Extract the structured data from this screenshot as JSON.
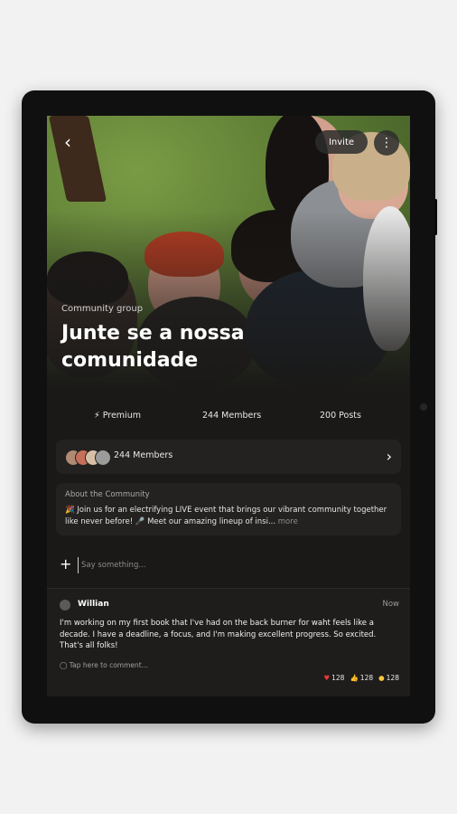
{
  "header": {
    "invite_label": "Invite"
  },
  "community": {
    "type_label": "Community group",
    "title": "Junte se a nossa comunidade"
  },
  "stats": {
    "premium_label": "Premium",
    "members_label": "244 Members",
    "posts_label": "200 Posts"
  },
  "members_card": {
    "label": "244 Members"
  },
  "about": {
    "title": "About the Community",
    "text": "🎉 Join us for an electrifying LIVE event that brings our vibrant  community together like never before! 🎤 Meet our amazing lineup of  insi...",
    "more_label": "more"
  },
  "compose": {
    "placeholder": "Say something..."
  },
  "post": {
    "author": "Willian",
    "time": "Now",
    "body": "I'm working on my first book that I've had on the back burner for waht feels like a decade. I have a deadline, a focus, and I'm making excellent progress. So excited. That's all folks!",
    "comment_prompt": "Tap here to comment...",
    "reactions": {
      "heart": "128",
      "thumbs_up": "128",
      "other": "128"
    }
  },
  "colors": {
    "background": "#f2f2f2",
    "device": "#101010",
    "screen": "#1a1918",
    "card": "#232221",
    "heart": "#e53935"
  }
}
